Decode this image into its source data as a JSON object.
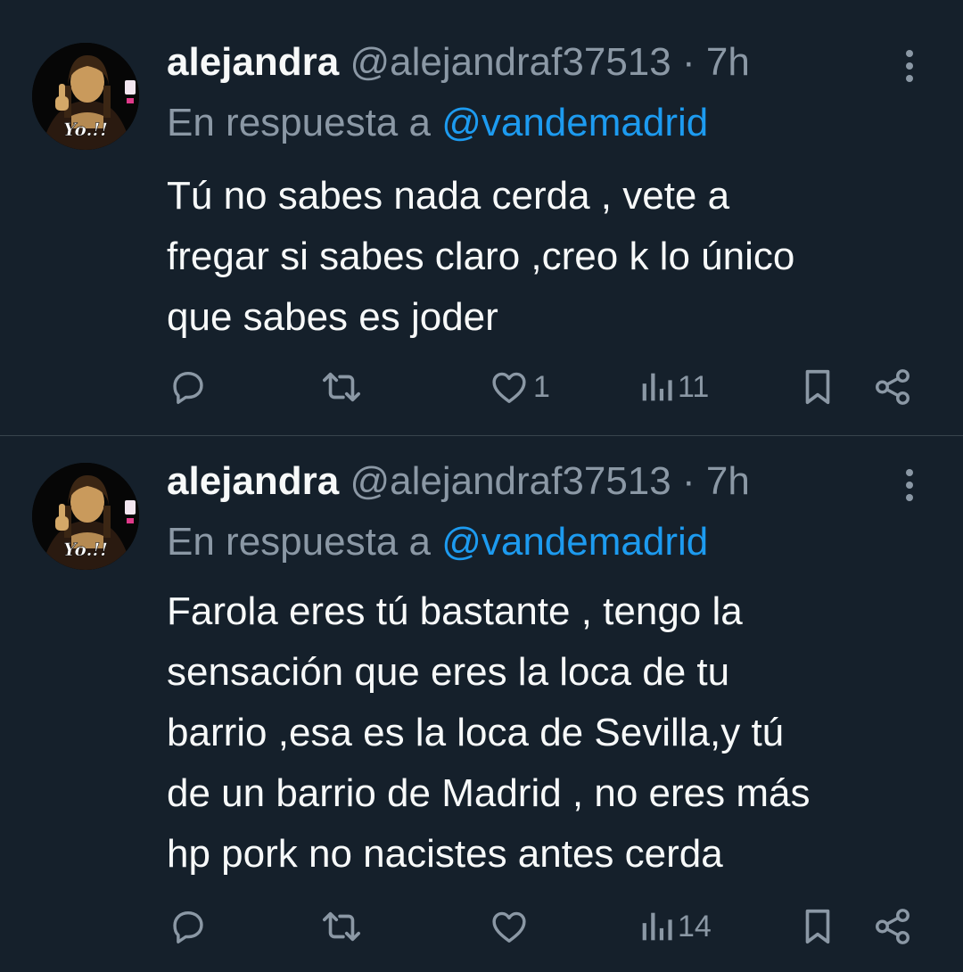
{
  "tweets": [
    {
      "author": {
        "name": "alejandra",
        "handle": "@alejandraf37513",
        "avatar_text": "Yo.!!"
      },
      "separator": "·",
      "time": "7h",
      "reply_prefix": "En respuesta a",
      "reply_to": "@vandemadrid",
      "text_lines": [
        "Tú no sabes nada cerda , vete a",
        "fregar  si sabes claro ,creo k lo único",
        "que sabes es joder"
      ],
      "stats": {
        "likes": "1",
        "views": "11"
      }
    },
    {
      "author": {
        "name": "alejandra",
        "handle": "@alejandraf37513",
        "avatar_text": "Yo.!!"
      },
      "separator": "·",
      "time": "7h",
      "reply_prefix": "En respuesta a",
      "reply_to": "@vandemadrid",
      "text_lines": [
        "Farola eres tú bastante , tengo la",
        "sensación que eres la loca de tu",
        "barrio ,esa es la loca de Sevilla,y tú",
        "de un barrio de Madrid , no eres más",
        "hp pork no nacistes antes cerda"
      ],
      "stats": {
        "likes": "",
        "views": "14"
      }
    }
  ],
  "icons": {
    "reply": "reply-icon",
    "retweet": "retweet-icon",
    "like": "heart-icon",
    "views": "views-icon",
    "bookmark": "bookmark-icon",
    "share": "share-icon",
    "more": "more-icon"
  },
  "colors": {
    "background": "#15202b",
    "text": "#f7f9f9",
    "secondary": "#8b98a5",
    "accent": "#1d9bf0",
    "divider": "#38444d"
  }
}
